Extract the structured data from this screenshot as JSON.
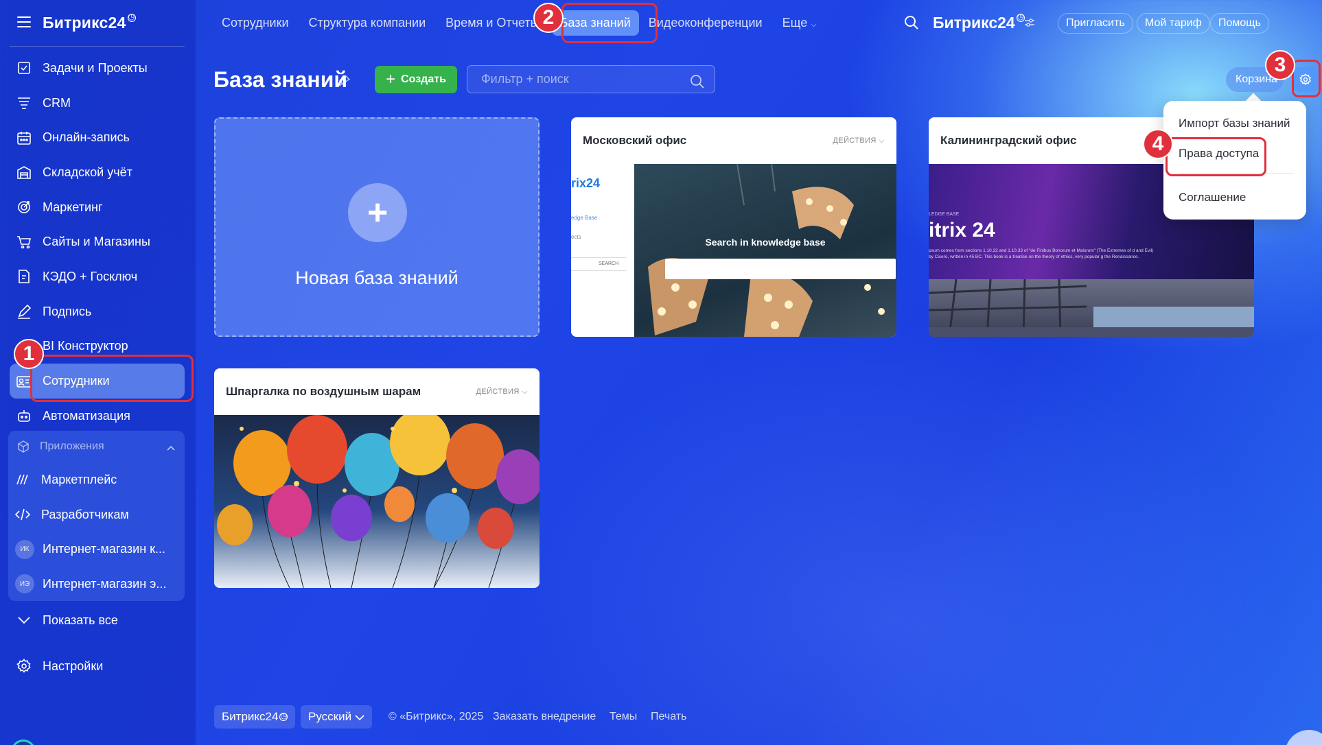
{
  "sidebar": {
    "logo": "Битрикс24",
    "items": [
      {
        "label": "Задачи и Проекты",
        "icon": "checkbox-icon"
      },
      {
        "label": "CRM",
        "icon": "crm-filter-icon"
      },
      {
        "label": "Онлайн-запись",
        "icon": "calendar-icon"
      },
      {
        "label": "Складской учёт",
        "icon": "warehouse-icon"
      },
      {
        "label": "Маркетинг",
        "icon": "target-icon"
      },
      {
        "label": "Сайты и Магазины",
        "icon": "cart-icon"
      },
      {
        "label": "КЭДО + Госключ",
        "icon": "document-icon"
      },
      {
        "label": "Подпись",
        "icon": "pen-icon"
      },
      {
        "label": "BI Конструктор",
        "icon": "chart-icon"
      },
      {
        "label": "Сотрудники",
        "icon": "employees-icon"
      },
      {
        "label": "Автоматизация",
        "icon": "robot-icon"
      }
    ],
    "group": {
      "title": "Приложения",
      "items": [
        {
          "label": "Маркетплейс",
          "icon": "marketplace-icon"
        },
        {
          "label": "Разработчикам",
          "icon": "code-icon"
        },
        {
          "label": "Интернет-магазин к...",
          "badge": "ИК"
        },
        {
          "label": "Интернет-магазин э...",
          "badge": "ИЭ"
        }
      ]
    },
    "show_all": "Показать все",
    "settings": "Настройки"
  },
  "topbar": {
    "links": [
      "Сотрудники",
      "Структура компании",
      "Время и Отчеты",
      "База знаний",
      "Видеоконференции",
      "Еще"
    ],
    "brand": "Битрикс24",
    "invite": "Пригласить",
    "tariff": "Мой тариф",
    "help": "Помощь"
  },
  "header": {
    "title": "База знаний",
    "create": "Создать",
    "search_placeholder": "Фильтр + поиск",
    "trash": "Корзина"
  },
  "cards": {
    "new_label": "Новая база знаний",
    "moscow": {
      "title": "Московский офис",
      "actions": "ДЕЙСТВИЯ",
      "thumb_logo": "rix24",
      "thumb_link1": "edge Base",
      "thumb_link2": "ects",
      "thumb_search": "Search in knowledge base",
      "thumb_search_btn": "SEARCH"
    },
    "kaliningrad": {
      "title": "Калининградский офис",
      "thumb_small": "LEDGE BASE",
      "thumb_big": "itrix 24",
      "thumb_text": "psum comes from sections 1.10.32 and 1.10.33 of \"de Finibus Bonorum et Malorum\" (The Extremes of d and Evil) by Cicero, written in 45 BC. This book is a treatise on the theory of ethics, very popular g the Renaissance."
    },
    "balloons": {
      "title": "Шпаргалка по воздушным шарам",
      "actions": "ДЕЙСТВИЯ"
    }
  },
  "dropdown": {
    "import": "Импорт базы знаний",
    "access": "Права доступа",
    "agreement": "Соглашение"
  },
  "footer": {
    "brand": "Битрикс24",
    "language": "Русский",
    "copyright": "© «Битрикс», 2025",
    "order": "Заказать внедрение",
    "themes": "Темы",
    "print": "Печать"
  },
  "callouts": [
    "1",
    "2",
    "3",
    "4"
  ],
  "colors": {
    "accent_green": "#36b24c",
    "callout_red": "#e0303c",
    "bg_blue": "#1f45e6"
  }
}
